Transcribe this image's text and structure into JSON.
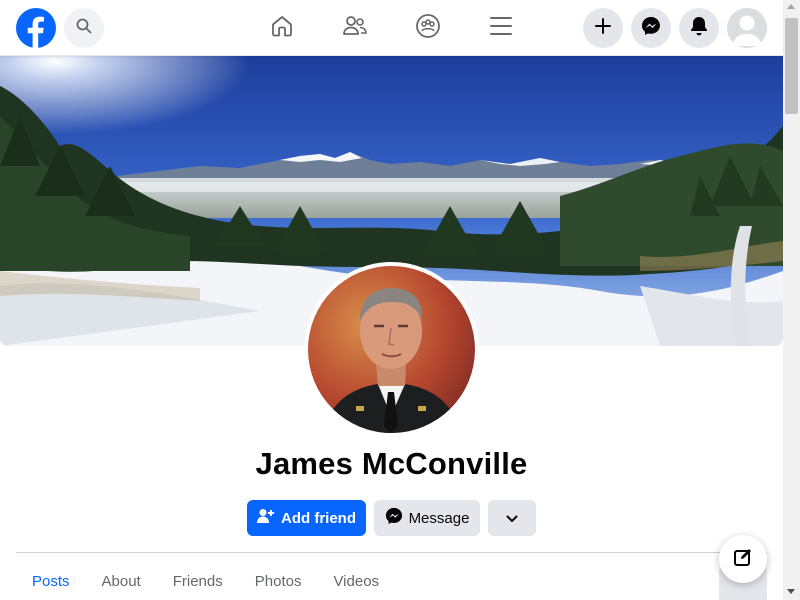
{
  "colors": {
    "brand": "#0866ff",
    "button_gray": "#e4e6eb",
    "text_primary": "#050505",
    "text_secondary": "#65676b"
  },
  "topbar": {
    "logo_icon": "facebook-logo-icon",
    "search_icon": "search-icon",
    "nav_icons": [
      "home-icon",
      "friends-icon",
      "groups-icon",
      "menu-icon"
    ],
    "action_icons": [
      "plus-icon",
      "messenger-icon",
      "bell-icon",
      "avatar-icon"
    ]
  },
  "profile": {
    "name": "James McConville",
    "add_friend_label": "Add friend",
    "message_label": "Message",
    "more_icon": "chevron-down-icon"
  },
  "tabs": [
    {
      "label": "Posts",
      "active": true
    },
    {
      "label": "About",
      "active": false
    },
    {
      "label": "Friends",
      "active": false
    },
    {
      "label": "Photos",
      "active": false
    },
    {
      "label": "Videos",
      "active": false
    }
  ],
  "compose_icon": "compose-icon"
}
